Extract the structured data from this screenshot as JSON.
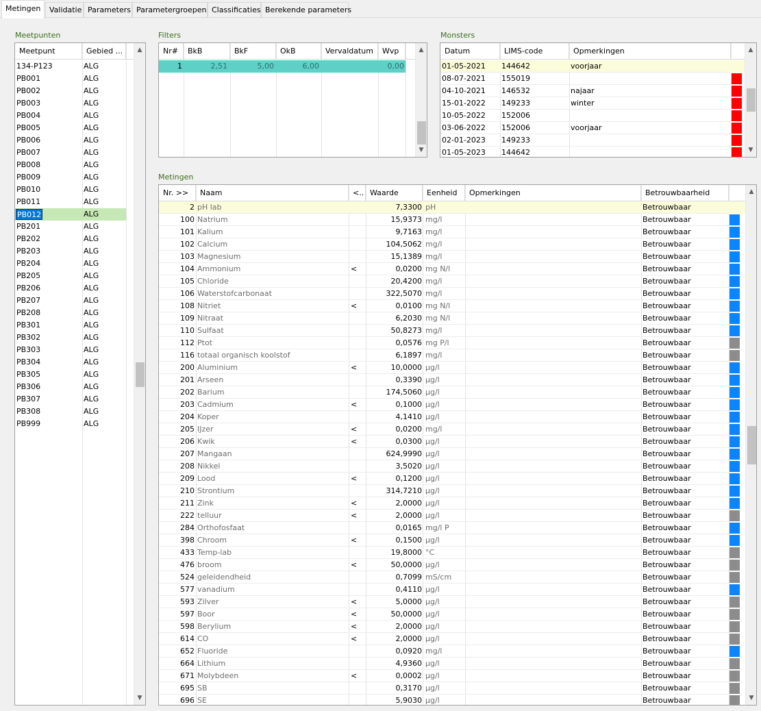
{
  "tabs": [
    "Metingen",
    "Validatie",
    "Parameters",
    "Parametergroepen",
    "Classificaties",
    "Berekende parameters"
  ],
  "meetpunten": {
    "title": "Meetpunten",
    "headers": [
      "Meetpunt",
      "Gebied ..."
    ],
    "rows": [
      [
        "134-P123",
        "ALG"
      ],
      [
        "PB001",
        "ALG"
      ],
      [
        "PB002",
        "ALG"
      ],
      [
        "PB003",
        "ALG"
      ],
      [
        "PB004",
        "ALG"
      ],
      [
        "PB005",
        "ALG"
      ],
      [
        "PB006",
        "ALG"
      ],
      [
        "PB007",
        "ALG"
      ],
      [
        "PB008",
        "ALG"
      ],
      [
        "PB009",
        "ALG"
      ],
      [
        "PB010",
        "ALG"
      ],
      [
        "PB011",
        "ALG"
      ],
      [
        "PB012",
        "ALG"
      ],
      [
        "PB201",
        "ALG"
      ],
      [
        "PB202",
        "ALG"
      ],
      [
        "PB203",
        "ALG"
      ],
      [
        "PB204",
        "ALG"
      ],
      [
        "PB205",
        "ALG"
      ],
      [
        "PB206",
        "ALG"
      ],
      [
        "PB207",
        "ALG"
      ],
      [
        "PB208",
        "ALG"
      ],
      [
        "PB301",
        "ALG"
      ],
      [
        "PB302",
        "ALG"
      ],
      [
        "PB303",
        "ALG"
      ],
      [
        "PB304",
        "ALG"
      ],
      [
        "PB305",
        "ALG"
      ],
      [
        "PB306",
        "ALG"
      ],
      [
        "PB307",
        "ALG"
      ],
      [
        "PB308",
        "ALG"
      ],
      [
        "PB999",
        "ALG"
      ]
    ],
    "selected_index": 12
  },
  "filters": {
    "title": "Filters",
    "headers": [
      "Nr#",
      "BkB",
      "BkF",
      "OkB",
      "Vervaldatum",
      "Wvp"
    ],
    "rows": [
      [
        "1",
        "2,51",
        "5,00",
        "6,00",
        "",
        "0,00"
      ]
    ]
  },
  "monsters": {
    "title": "Monsters",
    "headers": [
      "Datum",
      "LIMS-code",
      "Opmerkingen"
    ],
    "rows": [
      {
        "datum": "01-05-2021",
        "lims": "144642",
        "opm": "voorjaar",
        "mark": "none"
      },
      {
        "datum": "08-07-2021",
        "lims": "155019",
        "opm": "",
        "mark": "red"
      },
      {
        "datum": "04-10-2021",
        "lims": "146532",
        "opm": "najaar",
        "mark": "red"
      },
      {
        "datum": "15-01-2022",
        "lims": "149233",
        "opm": "winter",
        "mark": "red"
      },
      {
        "datum": "10-05-2022",
        "lims": "152006",
        "opm": "",
        "mark": "red"
      },
      {
        "datum": "03-06-2022",
        "lims": "152006",
        "opm": "voorjaar",
        "mark": "red"
      },
      {
        "datum": "02-01-2023",
        "lims": "149233",
        "opm": "",
        "mark": "red"
      },
      {
        "datum": "01-05-2023",
        "lims": "144642",
        "opm": "",
        "mark": "red"
      }
    ]
  },
  "metingen": {
    "title": "Metingen",
    "headers": [
      "Nr. >>",
      "Naam",
      "<..",
      "Waarde",
      "Eenheid",
      "Opmerkingen",
      "Betrouwbaarheid"
    ],
    "rows": [
      {
        "nr": "2",
        "naam": "pH lab",
        "lt": "",
        "waarde": "7,3300",
        "eenheid": "pH",
        "betr": "Betrouwbaar",
        "mark": "none"
      },
      {
        "nr": "100",
        "naam": "Natrium",
        "lt": "",
        "waarde": "15,9373",
        "eenheid": "mg/l",
        "betr": "Betrouwbaar",
        "mark": "blue"
      },
      {
        "nr": "101",
        "naam": "Kalium",
        "lt": "",
        "waarde": "9,7163",
        "eenheid": "mg/l",
        "betr": "Betrouwbaar",
        "mark": "blue"
      },
      {
        "nr": "102",
        "naam": "Calcium",
        "lt": "",
        "waarde": "104,5062",
        "eenheid": "mg/l",
        "betr": "Betrouwbaar",
        "mark": "blue"
      },
      {
        "nr": "103",
        "naam": "Magnesium",
        "lt": "",
        "waarde": "15,1389",
        "eenheid": "mg/l",
        "betr": "Betrouwbaar",
        "mark": "blue"
      },
      {
        "nr": "104",
        "naam": "Ammonium",
        "lt": "<",
        "waarde": "0,0200",
        "eenheid": "mg N/l",
        "betr": "Betrouwbaar",
        "mark": "blue"
      },
      {
        "nr": "105",
        "naam": "Chloride",
        "lt": "",
        "waarde": "20,4200",
        "eenheid": "mg/l",
        "betr": "Betrouwbaar",
        "mark": "blue"
      },
      {
        "nr": "106",
        "naam": "Waterstofcarbonaat",
        "lt": "",
        "waarde": "322,5070",
        "eenheid": "mg/l",
        "betr": "Betrouwbaar",
        "mark": "blue"
      },
      {
        "nr": "108",
        "naam": "Nitriet",
        "lt": "<",
        "waarde": "0,0100",
        "eenheid": "mg N/l",
        "betr": "Betrouwbaar",
        "mark": "blue"
      },
      {
        "nr": "109",
        "naam": "Nitraat",
        "lt": "",
        "waarde": "6,2030",
        "eenheid": "mg N/l",
        "betr": "Betrouwbaar",
        "mark": "blue"
      },
      {
        "nr": "110",
        "naam": "Sulfaat",
        "lt": "",
        "waarde": "50,8273",
        "eenheid": "mg/l",
        "betr": "Betrouwbaar",
        "mark": "blue"
      },
      {
        "nr": "112",
        "naam": "Ptot",
        "lt": "",
        "waarde": "0,0576",
        "eenheid": "mg P/l",
        "betr": "Betrouwbaar",
        "mark": "grey"
      },
      {
        "nr": "116",
        "naam": "totaal organisch koolstof",
        "lt": "",
        "waarde": "6,1897",
        "eenheid": "mg/l",
        "betr": "Betrouwbaar",
        "mark": "grey"
      },
      {
        "nr": "200",
        "naam": "Aluminium",
        "lt": "<",
        "waarde": "10,0000",
        "eenheid": "µg/l",
        "betr": "Betrouwbaar",
        "mark": "blue"
      },
      {
        "nr": "201",
        "naam": "Arseen",
        "lt": "",
        "waarde": "0,3390",
        "eenheid": "µg/l",
        "betr": "Betrouwbaar",
        "mark": "blue"
      },
      {
        "nr": "202",
        "naam": "Barium",
        "lt": "",
        "waarde": "174,5060",
        "eenheid": "µg/l",
        "betr": "Betrouwbaar",
        "mark": "blue"
      },
      {
        "nr": "203",
        "naam": "Cadmium",
        "lt": "<",
        "waarde": "0,1000",
        "eenheid": "µg/l",
        "betr": "Betrouwbaar",
        "mark": "blue"
      },
      {
        "nr": "204",
        "naam": "Koper",
        "lt": "",
        "waarde": "4,1410",
        "eenheid": "µg/l",
        "betr": "Betrouwbaar",
        "mark": "blue"
      },
      {
        "nr": "205",
        "naam": "IJzer",
        "lt": "<",
        "waarde": "0,0200",
        "eenheid": "mg/l",
        "betr": "Betrouwbaar",
        "mark": "blue"
      },
      {
        "nr": "206",
        "naam": "Kwik",
        "lt": "<",
        "waarde": "0,0300",
        "eenheid": "µg/l",
        "betr": "Betrouwbaar",
        "mark": "blue"
      },
      {
        "nr": "207",
        "naam": "Mangaan",
        "lt": "",
        "waarde": "624,9990",
        "eenheid": "µg/l",
        "betr": "Betrouwbaar",
        "mark": "blue"
      },
      {
        "nr": "208",
        "naam": "Nikkel",
        "lt": "",
        "waarde": "3,5020",
        "eenheid": "µg/l",
        "betr": "Betrouwbaar",
        "mark": "blue"
      },
      {
        "nr": "209",
        "naam": "Lood",
        "lt": "<",
        "waarde": "0,1200",
        "eenheid": "µg/l",
        "betr": "Betrouwbaar",
        "mark": "blue"
      },
      {
        "nr": "210",
        "naam": "Strontium",
        "lt": "",
        "waarde": "314,7210",
        "eenheid": "µg/l",
        "betr": "Betrouwbaar",
        "mark": "blue"
      },
      {
        "nr": "211",
        "naam": "Zink",
        "lt": "<",
        "waarde": "2,0000",
        "eenheid": "µg/l",
        "betr": "Betrouwbaar",
        "mark": "blue"
      },
      {
        "nr": "222",
        "naam": "telluur",
        "lt": "<",
        "waarde": "2,0000",
        "eenheid": "µg/l",
        "betr": "Betrouwbaar",
        "mark": "grey"
      },
      {
        "nr": "284",
        "naam": "Orthofosfaat",
        "lt": "",
        "waarde": "0,0165",
        "eenheid": "mg/l P",
        "betr": "Betrouwbaar",
        "mark": "blue"
      },
      {
        "nr": "398",
        "naam": "Chroom",
        "lt": "<",
        "waarde": "0,1500",
        "eenheid": "µg/l",
        "betr": "Betrouwbaar",
        "mark": "blue"
      },
      {
        "nr": "433",
        "naam": "Temp-lab",
        "lt": "",
        "waarde": "19,8000",
        "eenheid": "°C",
        "betr": "Betrouwbaar",
        "mark": "grey"
      },
      {
        "nr": "476",
        "naam": "broom",
        "lt": "<",
        "waarde": "50,0000",
        "eenheid": "µg/l",
        "betr": "Betrouwbaar",
        "mark": "grey"
      },
      {
        "nr": "524",
        "naam": "geleidendheid",
        "lt": "",
        "waarde": "0,7099",
        "eenheid": "mS/cm",
        "betr": "Betrouwbaar",
        "mark": "grey"
      },
      {
        "nr": "577",
        "naam": "vanadium",
        "lt": "",
        "waarde": "0,4110",
        "eenheid": "µg/l",
        "betr": "Betrouwbaar",
        "mark": "blue"
      },
      {
        "nr": "593",
        "naam": "Zilver",
        "lt": "<",
        "waarde": "5,0000",
        "eenheid": "µg/l",
        "betr": "Betrouwbaar",
        "mark": "grey"
      },
      {
        "nr": "597",
        "naam": "Boor",
        "lt": "<",
        "waarde": "50,0000",
        "eenheid": "µg/l",
        "betr": "Betrouwbaar",
        "mark": "grey"
      },
      {
        "nr": "598",
        "naam": "Berylium",
        "lt": "<",
        "waarde": "2,0000",
        "eenheid": "µg/l",
        "betr": "Betrouwbaar",
        "mark": "grey"
      },
      {
        "nr": "614",
        "naam": "CO",
        "lt": "<",
        "waarde": "2,0000",
        "eenheid": "µg/l",
        "betr": "Betrouwbaar",
        "mark": "grey"
      },
      {
        "nr": "652",
        "naam": "Fluoride",
        "lt": "",
        "waarde": "0,0920",
        "eenheid": "mg/l",
        "betr": "Betrouwbaar",
        "mark": "blue"
      },
      {
        "nr": "664",
        "naam": "Lithium",
        "lt": "",
        "waarde": "4,9360",
        "eenheid": "µg/l",
        "betr": "Betrouwbaar",
        "mark": "grey"
      },
      {
        "nr": "671",
        "naam": "Molybdeen",
        "lt": "<",
        "waarde": "0,0002",
        "eenheid": "µg/l",
        "betr": "Betrouwbaar",
        "mark": "grey"
      },
      {
        "nr": "695",
        "naam": "SB",
        "lt": "",
        "waarde": "0,3170",
        "eenheid": "µg/l",
        "betr": "Betrouwbaar",
        "mark": "grey"
      },
      {
        "nr": "696",
        "naam": "SE",
        "lt": "",
        "waarde": "5,9030",
        "eenheid": "µg/l",
        "betr": "Betrouwbaar",
        "mark": "grey"
      }
    ]
  },
  "colors": {
    "selected_row": "#c6e8b4",
    "selected_text_bg": "#0078d7",
    "highlight_row": "#fbfcd9",
    "filter_row": "#5ed0c6",
    "mark_red": "#ff0000",
    "mark_blue": "#0a84ff",
    "mark_grey": "#8c8c8c",
    "group_title": "#3c6e1e"
  },
  "icons": {
    "scroll_up": "chevron-up-icon",
    "scroll_down": "chevron-down-icon"
  }
}
